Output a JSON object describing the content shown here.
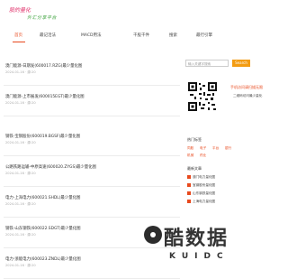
{
  "logo": {
    "line1": "股的量化",
    "line2": "外汇分享平台"
  },
  "nav": {
    "items": [
      {
        "label": "首页",
        "active": true
      },
      {
        "label": "最记活法"
      },
      {
        "label": "MACD用法"
      },
      {
        "label": "干股干件"
      },
      {
        "label": "搜索"
      },
      {
        "label": "最行引擎"
      }
    ]
  },
  "articles": [
    {
      "title": "澳门能源-日期发(600017.RZG)最少量化图",
      "date": "2024-01-16 · 源:20"
    },
    {
      "title": "澳门能源-上市展发(600015EGT)最少量化图",
      "date": "2024-01-16 · 源:20"
    },
    {
      "title": "钢铁-宝钢股份(600019.BGSF)最少量化图",
      "date": "2024-01-16 · 源:20"
    },
    {
      "title": "公路铁路运输-中原高速(600020.ZYGS)最少量化图",
      "date": "2024-01-16 · 源:20"
    },
    {
      "title": "电力-上海电力(600021.SHDL)最少量化图",
      "date": "2024-01-16 · 源:20"
    },
    {
      "title": "钢铁-山东钢铁(600022.SDGT)最少量化图",
      "date": "2024-01-16 · 源:20"
    },
    {
      "title": "电力-浙能电力(600023.ZNDL)最少量化图",
      "date": "2024-01-16 · 源:20"
    }
  ],
  "sidebar": {
    "search_placeholder": "输入关键字搜索",
    "search_button": "Search",
    "mp_title": "手机访问请扫描无限",
    "mp_sub": "二维码访问最少量化",
    "hot_tags_title": "热门标签",
    "tags": [
      "同股",
      "电子",
      "平台",
      "银行",
      "机械",
      "药业"
    ],
    "recommend_title": "最新文章",
    "recommend": [
      "澳门电力量化图",
      "宝钢股份量化图",
      "山东钢铁量化图",
      "上海电力量化图"
    ]
  },
  "watermark": {
    "big": "酷数据",
    "small": "KUIDC"
  },
  "colors": {
    "accent": "#e8491d",
    "search": "#f39c12"
  }
}
